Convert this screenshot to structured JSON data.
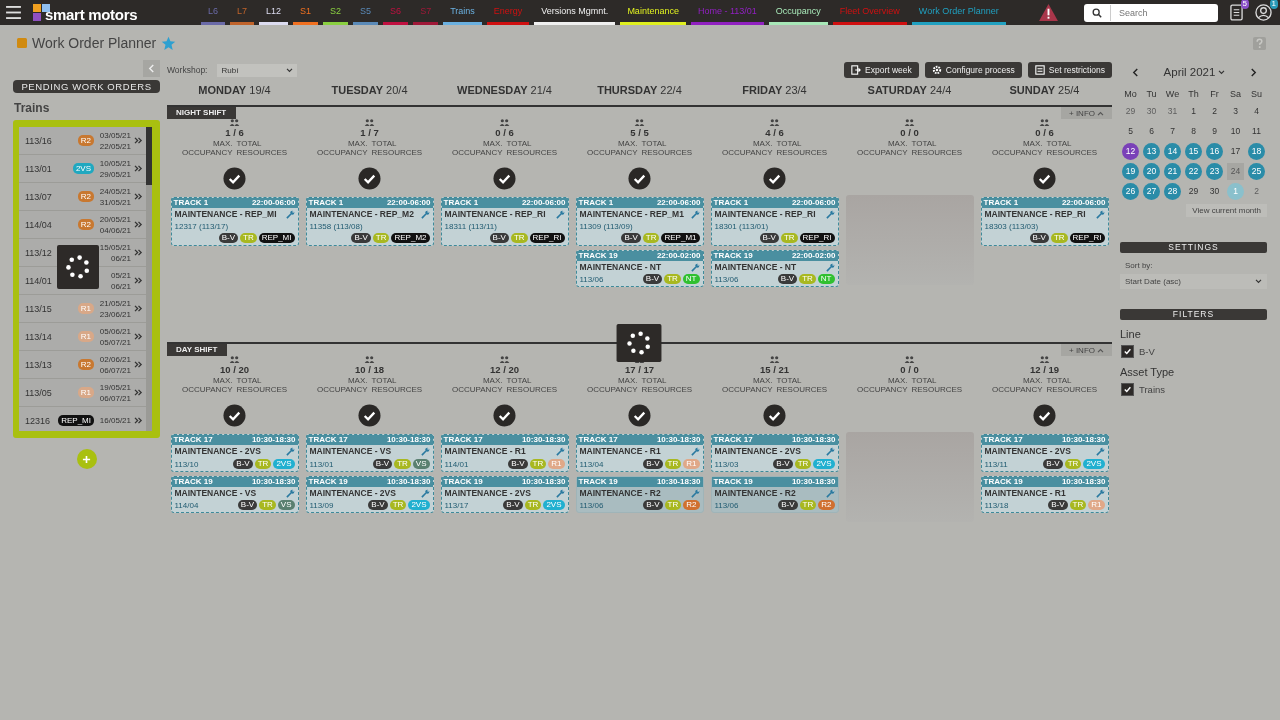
{
  "brand": {
    "name": "smart motors"
  },
  "nav": [
    {
      "label": "L6",
      "color": "#6a6aa8"
    },
    {
      "label": "L7",
      "color": "#c0632a"
    },
    {
      "label": "L12",
      "color": "#dcdcf0"
    },
    {
      "label": "S1",
      "color": "#f07020"
    },
    {
      "label": "S2",
      "color": "#8ad040"
    },
    {
      "label": "S5",
      "color": "#5a8ab8"
    },
    {
      "label": "S6",
      "color": "#c01040"
    },
    {
      "label": "S7",
      "color": "#a01838"
    },
    {
      "label": "Trains",
      "color": "#6ab0e0"
    },
    {
      "label": "Energy",
      "color": "#d01010"
    },
    {
      "label": "Versions Mgmnt.",
      "color": "#f0f0f0"
    },
    {
      "label": "Maintenance",
      "color": "#e0f020"
    },
    {
      "label": "Home - 113/01",
      "color": "#9020c0"
    },
    {
      "label": "Occupancy",
      "color": "#a8e8b8"
    },
    {
      "label": "Fleet Overview",
      "color": "#d01010"
    },
    {
      "label": "Work Order Planner",
      "color": "#20a0c0"
    }
  ],
  "search": {
    "placeholder": "Search"
  },
  "documents_badge": "5",
  "user_badge": "1",
  "page_title": "Work Order Planner",
  "pending": {
    "title": "PENDING WORK ORDERS",
    "group": "Trains",
    "loading": true,
    "rows": [
      {
        "id": "113/16",
        "badge": {
          "label": "R2",
          "color": "#c87830"
        },
        "start": "03/05/21",
        "end": "22/05/21"
      },
      {
        "id": "113/01",
        "badge": {
          "label": "2VS",
          "color": "#20a8c0"
        },
        "start": "10/05/21",
        "end": "29/05/21"
      },
      {
        "id": "113/07",
        "badge": {
          "label": "R2",
          "color": "#c87830"
        },
        "start": "24/05/21",
        "end": "31/05/21"
      },
      {
        "id": "114/04",
        "badge": {
          "label": "R2",
          "color": "#c87830"
        },
        "start": "20/05/21",
        "end": "04/06/21"
      },
      {
        "id": "113/12",
        "start": "15/05/21",
        "end": "06/21"
      },
      {
        "id": "114/01",
        "start": "05/21",
        "end": "06/21"
      },
      {
        "id": "113/15",
        "badge": {
          "label": "R1",
          "color": "#d8a888"
        },
        "start": "21/05/21",
        "end": "23/06/21"
      },
      {
        "id": "113/14",
        "badge": {
          "label": "R1",
          "color": "#d8a888"
        },
        "start": "05/06/21",
        "end": "05/07/21"
      },
      {
        "id": "113/13",
        "badge": {
          "label": "R2",
          "color": "#c87830"
        },
        "start": "02/06/21",
        "end": "06/07/21"
      },
      {
        "id": "113/05",
        "badge": {
          "label": "R1",
          "color": "#d8a888"
        },
        "start": "19/05/21",
        "end": "06/07/21"
      },
      {
        "id": "12316",
        "badge": {
          "label": "REP_MI",
          "color": "#111111"
        },
        "start": "16/05/21"
      }
    ]
  },
  "toolbar": {
    "workshop_label": "Workshop:",
    "workshop_value": "Rubí",
    "buttons": [
      "Export week",
      "Configure process",
      "Set restrictions"
    ]
  },
  "days": [
    {
      "name": "MONDAY",
      "date": "19/4"
    },
    {
      "name": "TUESDAY",
      "date": "20/4"
    },
    {
      "name": "WEDNESDAY",
      "date": "21/4"
    },
    {
      "name": "THURSDAY",
      "date": "22/4"
    },
    {
      "name": "FRIDAY",
      "date": "23/4"
    },
    {
      "name": "SATURDAY",
      "date": "24/4"
    },
    {
      "name": "SUNDAY",
      "date": "25/4"
    }
  ],
  "shifts": [
    {
      "label": "NIGHT SHIFT",
      "info": "+ INFO",
      "days": [
        {
          "kind": "open",
          "count": "1 / 6",
          "max_label": "MAX. OCCUPANCY",
          "total_label": "TOTAL RESOURCES",
          "orders": [
            {
              "kind": "tentative",
              "track": "TRACK 1",
              "time": "22:00-06:00",
              "title": "MAINTENANCE - REP_MI",
              "ref": "12317 (113/17)",
              "tags": [
                {
                  "label": "B-V",
                  "color": "#3a3a3a"
                },
                {
                  "label": "TR",
                  "color": "#a8b820"
                },
                {
                  "label": "REP_MI",
                  "color": "#111111"
                }
              ]
            }
          ]
        },
        {
          "kind": "open",
          "count": "1 / 7",
          "max_label": "MAX. OCCUPANCY",
          "total_label": "TOTAL RESOURCES",
          "orders": [
            {
              "kind": "tentative",
              "track": "TRACK 1",
              "time": "22:00-06:00",
              "title": "MAINTENANCE - REP_M2",
              "ref": "11358 (113/08)",
              "tags": [
                {
                  "label": "B-V",
                  "color": "#3a3a3a"
                },
                {
                  "label": "TR",
                  "color": "#a8b820"
                },
                {
                  "label": "REP_M2",
                  "color": "#111111"
                }
              ]
            }
          ]
        },
        {
          "kind": "open",
          "count": "0 / 6",
          "max_label": "MAX. OCCUPANCY",
          "total_label": "TOTAL RESOURCES",
          "orders": [
            {
              "kind": "tentative",
              "track": "TRACK 1",
              "time": "22:00-06:00",
              "title": "MAINTENANCE - REP_RI",
              "ref": "18311 (113/11)",
              "tags": [
                {
                  "label": "B-V",
                  "color": "#3a3a3a"
                },
                {
                  "label": "TR",
                  "color": "#a8b820"
                },
                {
                  "label": "REP_RI",
                  "color": "#111111"
                }
              ]
            }
          ]
        },
        {
          "kind": "open",
          "count": "5 / 5",
          "max_label": "MAX. OCCUPANCY",
          "total_label": "TOTAL RESOURCES",
          "orders": [
            {
              "kind": "tentative",
              "track": "TRACK 1",
              "time": "22:00-06:00",
              "title": "MAINTENANCE - REP_M1",
              "ref": "11309 (113/09)",
              "tags": [
                {
                  "label": "B-V",
                  "color": "#3a3a3a"
                },
                {
                  "label": "TR",
                  "color": "#a8b820"
                },
                {
                  "label": "REP_M1",
                  "color": "#111111"
                }
              ]
            },
            {
              "kind": "tentative",
              "track": "TRACK 19",
              "time": "22:00-02:00",
              "title": "MAINTENANCE - NT",
              "ref": "113/06",
              "tags": [
                {
                  "label": "B-V",
                  "color": "#3a3a3a"
                },
                {
                  "label": "TR",
                  "color": "#a8b820"
                },
                {
                  "label": "NT",
                  "color": "#30c030"
                }
              ]
            }
          ]
        },
        {
          "kind": "open",
          "count": "4 / 6",
          "max_label": "MAX. OCCUPANCY",
          "total_label": "TOTAL RESOURCES",
          "orders": [
            {
              "kind": "tentative",
              "track": "TRACK 1",
              "time": "22:00-06:00",
              "title": "MAINTENANCE - REP_RI",
              "ref": "18301 (113/01)",
              "tags": [
                {
                  "label": "B-V",
                  "color": "#3a3a3a"
                },
                {
                  "label": "TR",
                  "color": "#a8b820"
                },
                {
                  "label": "REP_RI",
                  "color": "#111111"
                }
              ]
            },
            {
              "kind": "tentative",
              "track": "TRACK 19",
              "time": "22:00-02:00",
              "title": "MAINTENANCE - NT",
              "ref": "113/06",
              "tags": [
                {
                  "label": "B-V",
                  "color": "#3a3a3a"
                },
                {
                  "label": "TR",
                  "color": "#a8b820"
                },
                {
                  "label": "NT",
                  "color": "#30c030"
                }
              ]
            }
          ]
        },
        {
          "kind": "closed",
          "count": "0 / 0",
          "max_label": "MAX. OCCUPANCY",
          "total_label": "TOTAL RESOURCES"
        },
        {
          "kind": "open",
          "count": "0 / 6",
          "max_label": "MAX. OCCUPANCY",
          "total_label": "TOTAL RESOURCES",
          "orders": [
            {
              "kind": "tentative",
              "track": "TRACK 1",
              "time": "22:00-06:00",
              "title": "MAINTENANCE - REP_RI",
              "ref": "18303 (113/03)",
              "tags": [
                {
                  "label": "B-V",
                  "color": "#3a3a3a"
                },
                {
                  "label": "TR",
                  "color": "#a8b820"
                },
                {
                  "label": "REP_RI",
                  "color": "#111111"
                }
              ]
            }
          ]
        }
      ]
    },
    {
      "label": "DAY SHIFT",
      "info": "+ INFO",
      "days": [
        {
          "kind": "open",
          "count": "10 / 20",
          "max_label": "MAX. OCCUPANCY",
          "total_label": "TOTAL RESOURCES",
          "orders": [
            {
              "kind": "tentative",
              "track": "TRACK 17",
              "time": "10:30-18:30",
              "title": "MAINTENANCE - 2VS",
              "ref": "113/10",
              "tags": [
                {
                  "label": "B-V",
                  "color": "#3a3a3a"
                },
                {
                  "label": "TR",
                  "color": "#a8b820"
                },
                {
                  "label": "2VS",
                  "color": "#20b0d0"
                }
              ]
            },
            {
              "kind": "tentative",
              "track": "TRACK 19",
              "time": "10:30-18:30",
              "title": "MAINTENANCE - VS",
              "ref": "114/04",
              "tags": [
                {
                  "label": "B-V",
                  "color": "#3a3a3a"
                },
                {
                  "label": "TR",
                  "color": "#a8b820"
                },
                {
                  "label": "VS",
                  "color": "#5a8070"
                }
              ]
            }
          ]
        },
        {
          "kind": "open",
          "count": "10 / 18",
          "max_label": "MAX. OCCUPANCY",
          "total_label": "TOTAL RESOURCES",
          "orders": [
            {
              "kind": "tentative",
              "track": "TRACK 17",
              "time": "10:30-18:30",
              "title": "MAINTENANCE - VS",
              "ref": "113/01",
              "tags": [
                {
                  "label": "B-V",
                  "color": "#3a3a3a"
                },
                {
                  "label": "TR",
                  "color": "#a8b820"
                },
                {
                  "label": "VS",
                  "color": "#5a8070"
                }
              ]
            },
            {
              "kind": "tentative",
              "track": "TRACK 19",
              "time": "10:30-18:30",
              "title": "MAINTENANCE - 2VS",
              "ref": "113/09",
              "tags": [
                {
                  "label": "B-V",
                  "color": "#3a3a3a"
                },
                {
                  "label": "TR",
                  "color": "#a8b820"
                },
                {
                  "label": "2VS",
                  "color": "#20b0d0"
                }
              ]
            }
          ]
        },
        {
          "kind": "open",
          "count": "12 / 20",
          "max_label": "MAX. OCCUPANCY",
          "total_label": "TOTAL RESOURCES",
          "orders": [
            {
              "kind": "tentative",
              "track": "TRACK 17",
              "time": "10:30-18:30",
              "title": "MAINTENANCE - R1",
              "ref": "114/01",
              "tags": [
                {
                  "label": "B-V",
                  "color": "#3a3a3a"
                },
                {
                  "label": "TR",
                  "color": "#a8b820"
                },
                {
                  "label": "R1",
                  "color": "#e0a888"
                }
              ]
            },
            {
              "kind": "tentative",
              "track": "TRACK 19",
              "time": "10:30-18:30",
              "title": "MAINTENANCE - 2VS",
              "ref": "113/17",
              "tags": [
                {
                  "label": "B-V",
                  "color": "#3a3a3a"
                },
                {
                  "label": "TR",
                  "color": "#a8b820"
                },
                {
                  "label": "2VS",
                  "color": "#20b0d0"
                }
              ]
            }
          ]
        },
        {
          "kind": "open",
          "loading": true,
          "count": "17 / 17",
          "max_label": "MAX. OCCUPANCY",
          "total_label": "TOTAL RESOURCES",
          "orders": [
            {
              "kind": "tentative",
              "track": "TRACK 17",
              "time": "10:30-18:30",
              "title": "MAINTENANCE - R1",
              "ref": "113/04",
              "tags": [
                {
                  "label": "B-V",
                  "color": "#3a3a3a"
                },
                {
                  "label": "TR",
                  "color": "#a8b820"
                },
                {
                  "label": "R1",
                  "color": "#e0a888"
                }
              ]
            },
            {
              "kind": "confirmed",
              "track": "TRACK 19",
              "time": "10:30-18:30",
              "title": "MAINTENANCE - R2",
              "ref": "113/06",
              "tags": [
                {
                  "label": "B-V",
                  "color": "#3a3a3a"
                },
                {
                  "label": "TR",
                  "color": "#a8b820"
                },
                {
                  "label": "R2",
                  "color": "#d07030"
                }
              ]
            }
          ]
        },
        {
          "kind": "open",
          "count": "15 / 21",
          "max_label": "MAX. OCCUPANCY",
          "total_label": "TOTAL RESOURCES",
          "orders": [
            {
              "kind": "tentative",
              "track": "TRACK 17",
              "time": "10:30-18:30",
              "title": "MAINTENANCE - 2VS",
              "ref": "113/03",
              "tags": [
                {
                  "label": "B-V",
                  "color": "#3a3a3a"
                },
                {
                  "label": "TR",
                  "color": "#a8b820"
                },
                {
                  "label": "2VS",
                  "color": "#20b0d0"
                }
              ]
            },
            {
              "kind": "confirmed",
              "track": "TRACK 19",
              "time": "10:30-18:30",
              "title": "MAINTENANCE - R2",
              "ref": "113/06",
              "tags": [
                {
                  "label": "B-V",
                  "color": "#3a3a3a"
                },
                {
                  "label": "TR",
                  "color": "#a8b820"
                },
                {
                  "label": "R2",
                  "color": "#d07030"
                }
              ]
            }
          ]
        },
        {
          "kind": "closed",
          "count": "0 / 0",
          "max_label": "MAX. OCCUPANCY",
          "total_label": "TOTAL RESOURCES"
        },
        {
          "kind": "open",
          "count": "12 / 19",
          "max_label": "MAX. OCCUPANCY",
          "total_label": "TOTAL RESOURCES",
          "orders": [
            {
              "kind": "tentative",
              "track": "TRACK 17",
              "time": "10:30-18:30",
              "title": "MAINTENANCE - 2VS",
              "ref": "113/11",
              "tags": [
                {
                  "label": "B-V",
                  "color": "#3a3a3a"
                },
                {
                  "label": "TR",
                  "color": "#a8b820"
                },
                {
                  "label": "2VS",
                  "color": "#20b0d0"
                }
              ]
            },
            {
              "kind": "tentative",
              "track": "TRACK 19",
              "time": "10:30-18:30",
              "title": "MAINTENANCE - R1",
              "ref": "113/18",
              "tags": [
                {
                  "label": "B-V",
                  "color": "#3a3a3a"
                },
                {
                  "label": "TR",
                  "color": "#a8b820"
                },
                {
                  "label": "R1",
                  "color": "#e0a888"
                }
              ]
            }
          ]
        }
      ]
    }
  ],
  "calendar": {
    "month": "April 2021",
    "weekdays": [
      "Mo",
      "Tu",
      "We",
      "Th",
      "Fr",
      "Sa",
      "Su"
    ],
    "weeks": [
      {
        "days": [
          {
            "label": "29",
            "kind": "outside"
          },
          {
            "label": "30",
            "kind": "outside"
          },
          {
            "label": "31",
            "kind": "outside"
          },
          {
            "label": "1",
            "kind": "plain"
          },
          {
            "label": "2",
            "kind": "plain"
          },
          {
            "label": "3",
            "kind": "plain"
          },
          {
            "label": "4",
            "kind": "plain"
          }
        ]
      },
      {
        "days": [
          {
            "label": "5",
            "kind": "plain"
          },
          {
            "label": "6",
            "kind": "plain"
          },
          {
            "label": "7",
            "kind": "plain"
          },
          {
            "label": "8",
            "kind": "plain"
          },
          {
            "label": "9",
            "kind": "plain"
          },
          {
            "label": "10",
            "kind": "plain"
          },
          {
            "label": "11",
            "kind": "plain"
          }
        ]
      },
      {
        "days": [
          {
            "label": "12",
            "kind": "today"
          },
          {
            "label": "13",
            "kind": "marked"
          },
          {
            "label": "14",
            "kind": "marked"
          },
          {
            "label": "15",
            "kind": "marked"
          },
          {
            "label": "16",
            "kind": "marked"
          },
          {
            "label": "17",
            "kind": "plain"
          },
          {
            "label": "18",
            "kind": "marked"
          }
        ]
      },
      {
        "days": [
          {
            "label": "19",
            "kind": "marked"
          },
          {
            "label": "20",
            "kind": "marked"
          },
          {
            "label": "21",
            "kind": "marked"
          },
          {
            "label": "22",
            "kind": "marked"
          },
          {
            "label": "23",
            "kind": "marked"
          },
          {
            "label": "24",
            "kind": "shaded"
          },
          {
            "label": "25",
            "kind": "marked"
          }
        ]
      },
      {
        "days": [
          {
            "label": "26",
            "kind": "marked"
          },
          {
            "label": "27",
            "kind": "marked"
          },
          {
            "label": "28",
            "kind": "marked"
          },
          {
            "label": "29",
            "kind": "plain"
          },
          {
            "label": "30",
            "kind": "plain"
          },
          {
            "label": "1",
            "kind": "outside-marked"
          },
          {
            "label": "2",
            "kind": "outside"
          }
        ]
      }
    ],
    "current_button": "View current month"
  },
  "settings": {
    "title": "SETTINGS",
    "sort_label": "Sort by:",
    "sort_value": "Start Date (asc)"
  },
  "filters": {
    "title": "FILTERS",
    "groups": [
      {
        "label": "Line",
        "options": [
          {
            "label": "B-V",
            "checked": true
          }
        ]
      },
      {
        "label": "Asset Type",
        "options": [
          {
            "label": "Trains",
            "checked": true
          }
        ]
      }
    ]
  }
}
